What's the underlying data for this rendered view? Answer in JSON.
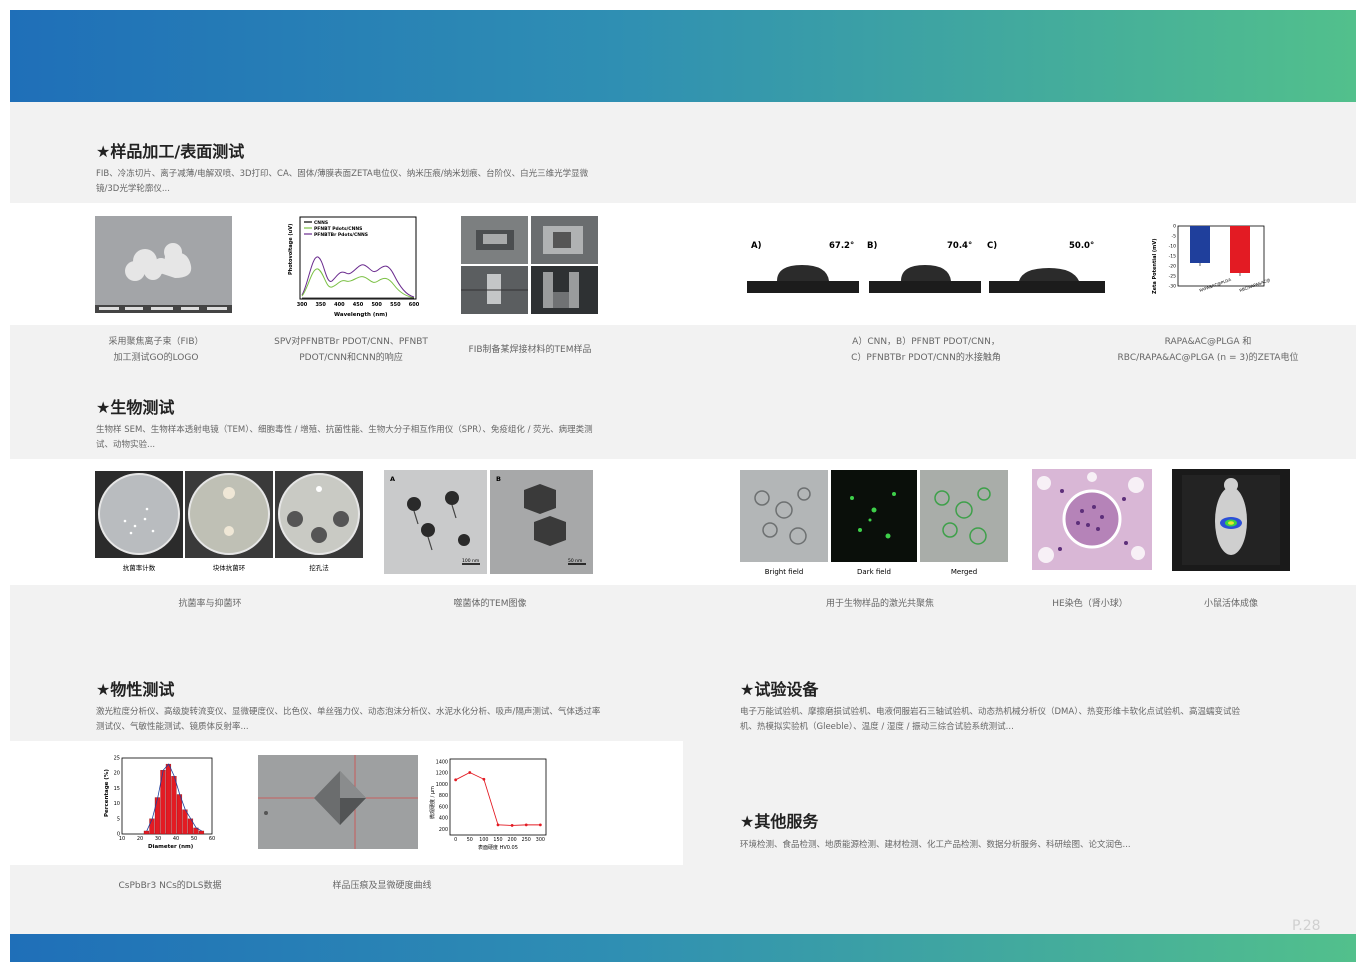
{
  "page_number": "P.28",
  "sections": {
    "processing": {
      "title": "★样品加工/表面测试",
      "desc": "FIB、冷冻切片、离子减薄/电解双喷、3D打印、CA、固体/薄膜表面ZETA电位仪、纳米压痕/纳米划痕、台阶仪、白光三维光学显微镜/3D光学轮廓仪..."
    },
    "bio": {
      "title": "★生物测试",
      "desc": "生物样 SEM、生物样本透射电镜（TEM）、细胞毒性 / 增殖、抗菌性能、生物大分子相互作用仪（SPR）、免疫组化 / 荧光、病理类测试、动物实验..."
    },
    "physical": {
      "title": "★物性测试",
      "desc": "激光粒度分析仪、高级旋转流变仪、显微硬度仪、比色仪、单丝强力仪、动态泡沫分析仪、水泥水化分析、吸声/隔声测试、气体透过率测试仪、气敏性能测试、镜质体反射率..."
    },
    "equipment": {
      "title": "★试验设备",
      "desc": "电子万能试验机、摩擦磨损试验机、电液伺服岩石三轴试验机、动态热机械分析仪（DMA）、热变形维卡软化点试验机、高温蠕变试验机、热模拟实验机（Gleeble）、温度 / 湿度 / 振动三综合试验系统测试..."
    },
    "other": {
      "title": "★其他服务",
      "desc": "环境检测、食品检测、地质能源检测、建材检测、化工产品检测、数据分析服务、科研绘图、论文润色..."
    }
  },
  "captions": {
    "fib_logo": [
      "采用聚焦离子束（FIB）",
      "加工测试GO的LOGO"
    ],
    "spv": [
      "SPV对PFNBTBr PDOT/CNN、PFNBT",
      "PDOT/CNN和CNN的响应"
    ],
    "fib_tem": "FIB制备某焊接材料的TEM样品",
    "contact_angle": [
      "A）CNN，B）PFNBT PDOT/CNN，",
      "C）PFNBTBr PDOT/CNN的水接触角"
    ],
    "zeta": [
      "RAPA&AC@PLGA 和",
      "RBC/RAPA&AC@PLGA (n = 3)的ZETA电位"
    ],
    "antibacterial": "抗菌率与抑菌环",
    "phage": "噬菌体的TEM图像",
    "confocal": "用于生物样品的激光共聚焦",
    "he": "HE染色（肾小球）",
    "mouse": "小鼠活体成像",
    "dls": "CsPbBr3 NCs的DLS数据",
    "hardness": "样品压痕及显微硬度曲线"
  },
  "figures": {
    "spv": {
      "legend": [
        "CNNS",
        "PFNBT Pdots/CNNS",
        "PFNBTBr Pdots/CNNS"
      ],
      "ylabel": "Photovoltage (uV)",
      "xlabel": "Wavelength (nm)",
      "xticks": [
        "300",
        "350",
        "400",
        "450",
        "500",
        "550",
        "600"
      ]
    },
    "contact_angle": {
      "labels": [
        "A)",
        "B)",
        "C)"
      ],
      "angles": [
        "67.2°",
        "70.4°",
        "50.0°"
      ]
    },
    "zeta": {
      "ylabel": "Zeta Potential (mV)",
      "yticks": [
        "0",
        "-5",
        "-10",
        "-15",
        "-20",
        "-25",
        "-30"
      ],
      "categories": [
        "RAPA&AC@PLGA",
        "RBC/RAPA&AC@PLGA"
      ],
      "values": [
        -18.5,
        -23.5
      ],
      "colors": [
        "#1f3f9c",
        "#e31b23"
      ]
    },
    "antibacterial": {
      "labels": [
        "抗菌率计数",
        "块体抗菌环",
        "挖孔法"
      ]
    },
    "phage": {
      "labels": [
        "A",
        "B"
      ],
      "scales": [
        "100 nm",
        "50 nm"
      ]
    },
    "confocal": {
      "labels": [
        "Bright field",
        "Dark field",
        "Merged"
      ]
    },
    "dls": {
      "ylabel": "Percentage (%)",
      "xlabel": "Diameter (nm)",
      "yticks": [
        "0",
        "5",
        "10",
        "15",
        "20",
        "25"
      ],
      "xticks": [
        "10",
        "20",
        "30",
        "40",
        "50",
        "60"
      ],
      "bars": [
        1,
        5,
        12,
        21,
        23,
        19,
        13,
        8,
        5,
        2,
        1
      ]
    },
    "hardness": {
      "ylabel": "微观硬度 / μm",
      "xlabel": "表面硬度 HV0.05",
      "yticks": [
        "200",
        "400",
        "600",
        "800",
        "1000",
        "1200",
        "1400"
      ],
      "xticks": [
        "0",
        "50",
        "100",
        "150",
        "200",
        "250",
        "300"
      ],
      "points": [
        [
          0,
          1080
        ],
        [
          50,
          1210
        ],
        [
          100,
          1090
        ],
        [
          150,
          280
        ],
        [
          200,
          270
        ],
        [
          250,
          280
        ],
        [
          300,
          280
        ]
      ]
    }
  }
}
